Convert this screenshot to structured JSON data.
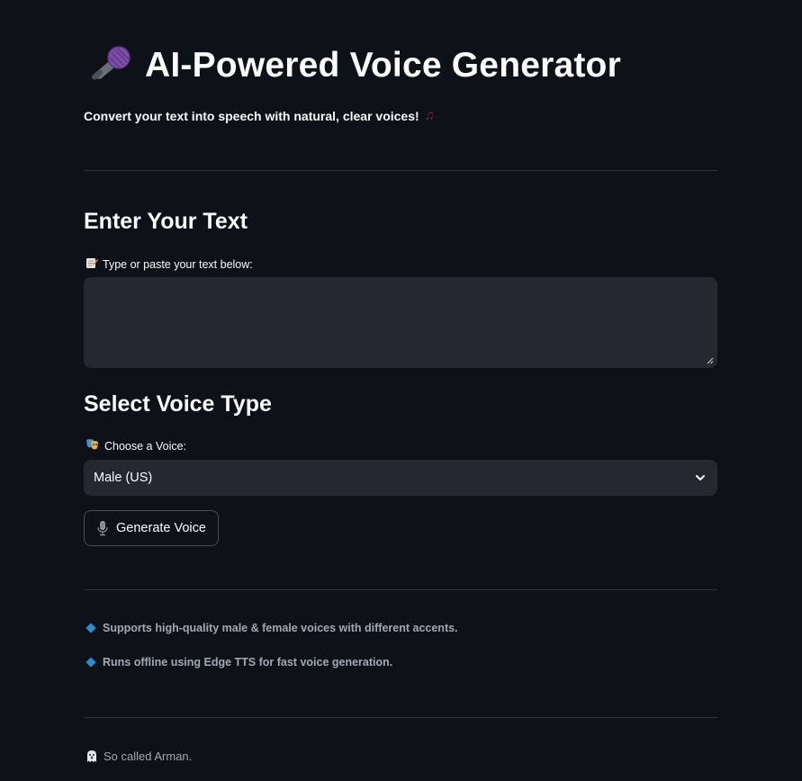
{
  "header": {
    "title": "AI-Powered Voice Generator",
    "subtitle": "Convert your text into speech with natural, clear voices!"
  },
  "text_section": {
    "heading": "Enter Your Text",
    "label": "Type or paste your text below:",
    "textarea_value": ""
  },
  "voice_section": {
    "heading": "Select Voice Type",
    "label": "Choose a Voice:",
    "selected_voice": "Male (US)"
  },
  "generate_button": {
    "label": "Generate Voice"
  },
  "info": {
    "bullets": [
      "Supports high-quality male & female voices with different accents.",
      "Runs offline using Edge TTS for fast voice generation."
    ]
  },
  "footer": {
    "text": "So called Arman."
  },
  "icons": {
    "title": "microphone-icon",
    "subtitle": "musical-notes-icon",
    "text_label": "memo-icon",
    "voice_label": "performing-arts-icon",
    "button": "studio-microphone-icon",
    "bullets": "blue-diamond-icon",
    "footer": "ghost-icon"
  },
  "colors": {
    "background": "#0e1117",
    "input_background": "#262730",
    "divider": "#31333f",
    "text": "#fafafa",
    "muted_text": "#a3a8b4",
    "bullet_diamond": "#2d8ccf"
  }
}
